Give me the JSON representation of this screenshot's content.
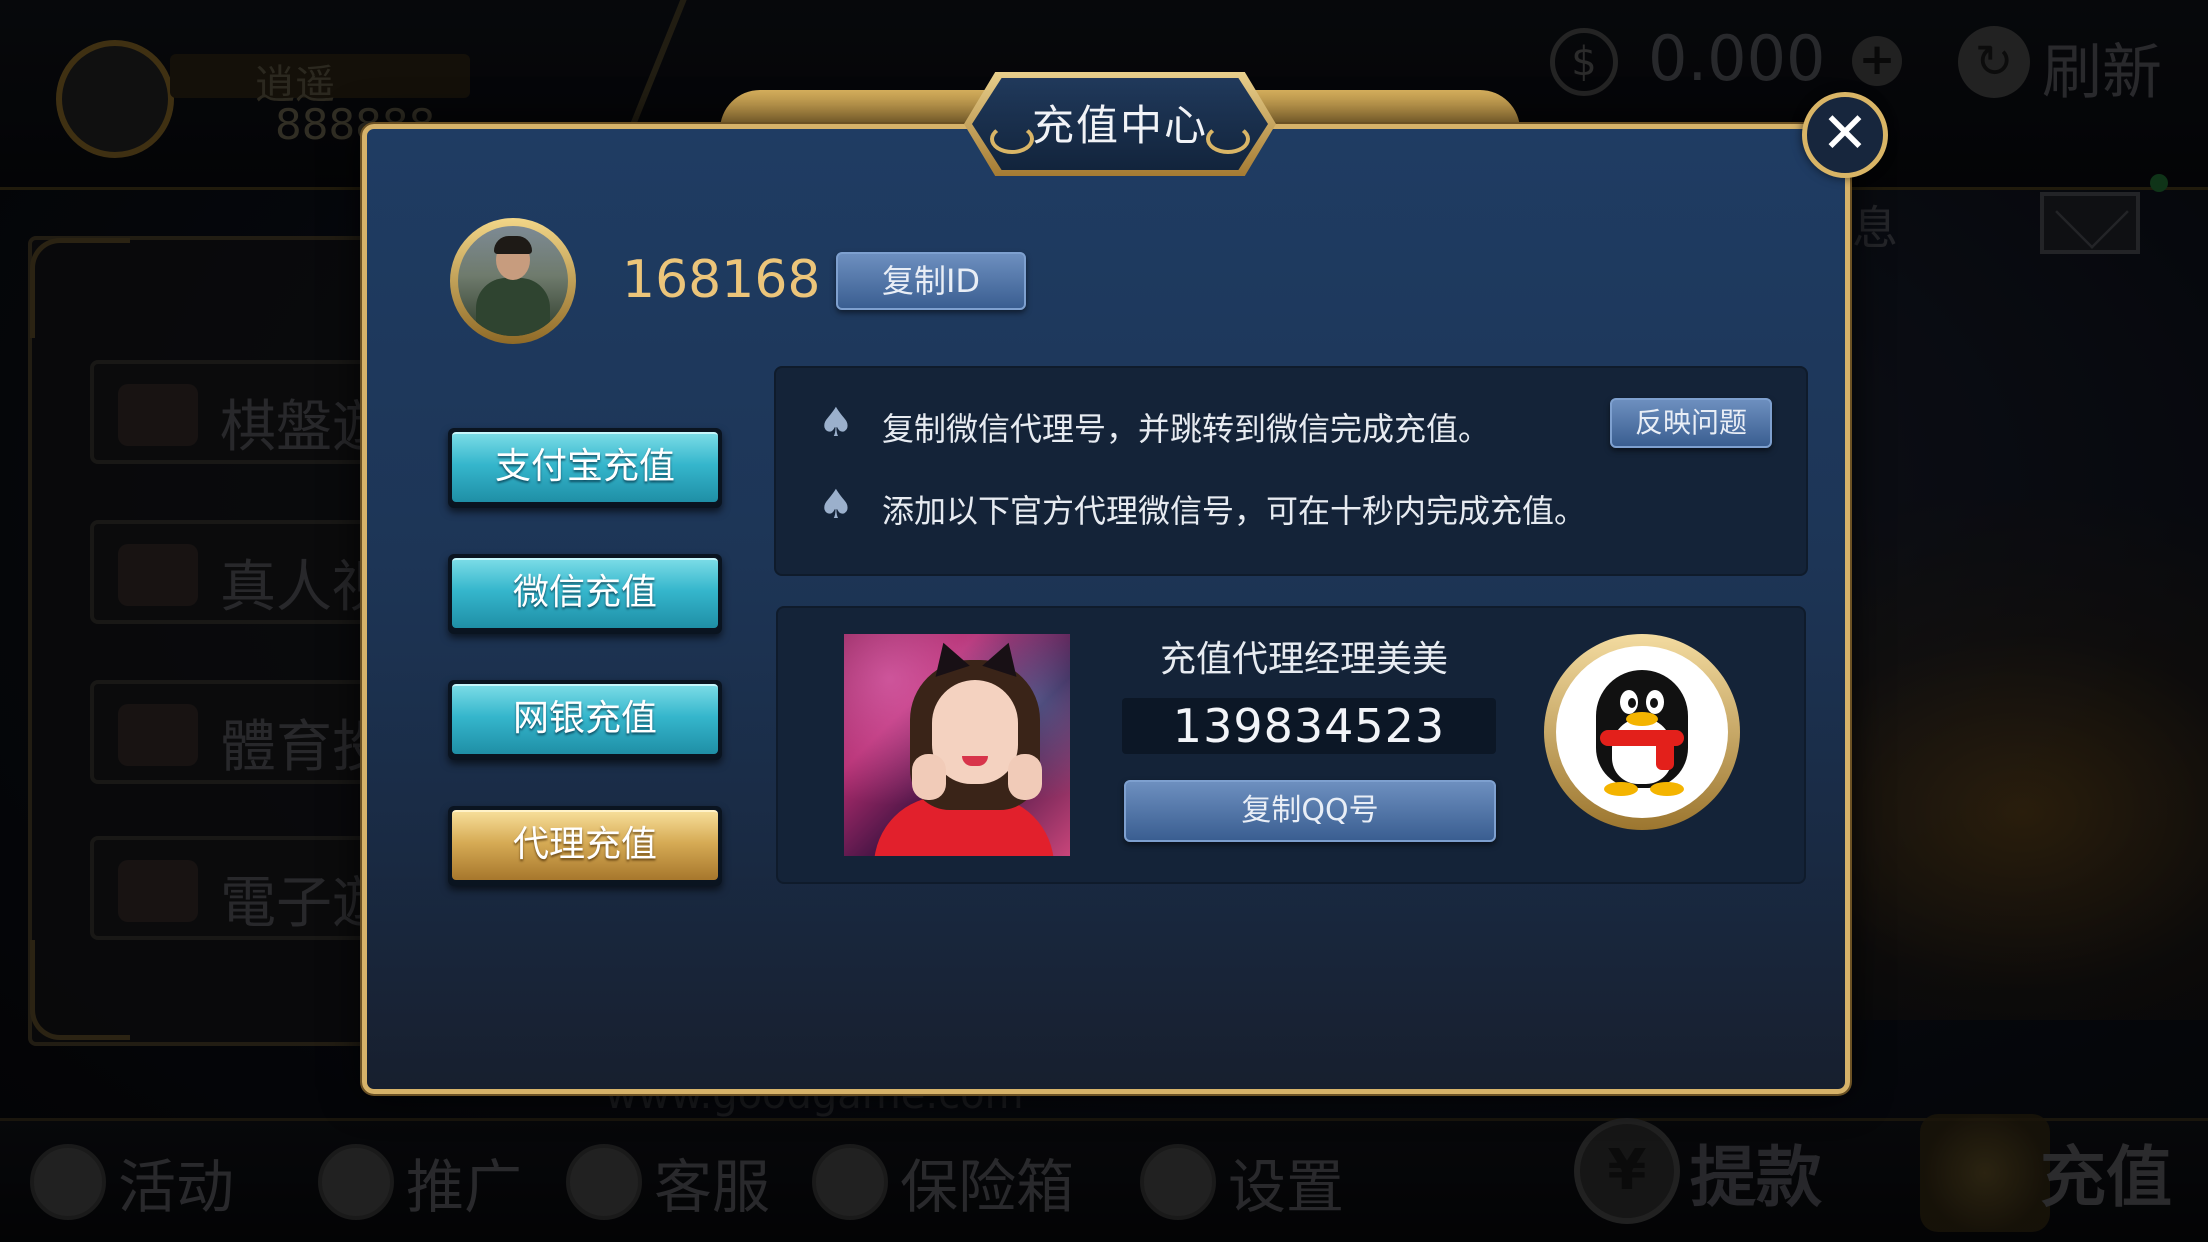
{
  "background": {
    "player_name": "逍遥",
    "player_id": "888888",
    "balance": "0.000",
    "refresh_label": "刷新",
    "notice_label": "息",
    "game_tabs": [
      "棋盤遊",
      "真人視",
      "體育投",
      "電子遊"
    ],
    "website": "www.goodgame.com",
    "bottom_menu": [
      "活动",
      "推广",
      "客服",
      "保险箱",
      "设置"
    ],
    "withdraw_label": "提款",
    "recharge_label": "充值"
  },
  "modal": {
    "title": "充值中心",
    "close_symbol": "✕",
    "user_id": "168168",
    "copy_id_label": "复制ID",
    "nav": [
      {
        "label": "支付宝充值",
        "active": false
      },
      {
        "label": "微信充值",
        "active": false
      },
      {
        "label": "网银充值",
        "active": false
      },
      {
        "label": "代理充值",
        "active": true
      }
    ],
    "info_lines": [
      "复制微信代理号，并跳转到微信完成充值。",
      "添加以下官方代理微信号，可在十秒内完成充值。"
    ],
    "feedback_label": "反映问题",
    "agent": {
      "name": "充值代理经理美美",
      "qq_number": "139834523",
      "copy_qq_label": "复制QQ号"
    }
  },
  "colors": {
    "gold": "#d6b269",
    "panel": "#142338",
    "nav_cyan": "#35b6cc",
    "nav_gold": "#d6ab55",
    "id_gold": "#ecc57a"
  },
  "icons": {
    "spade": "♠",
    "coin": "$",
    "add": "+",
    "refresh": "↻",
    "yuan": "¥"
  }
}
